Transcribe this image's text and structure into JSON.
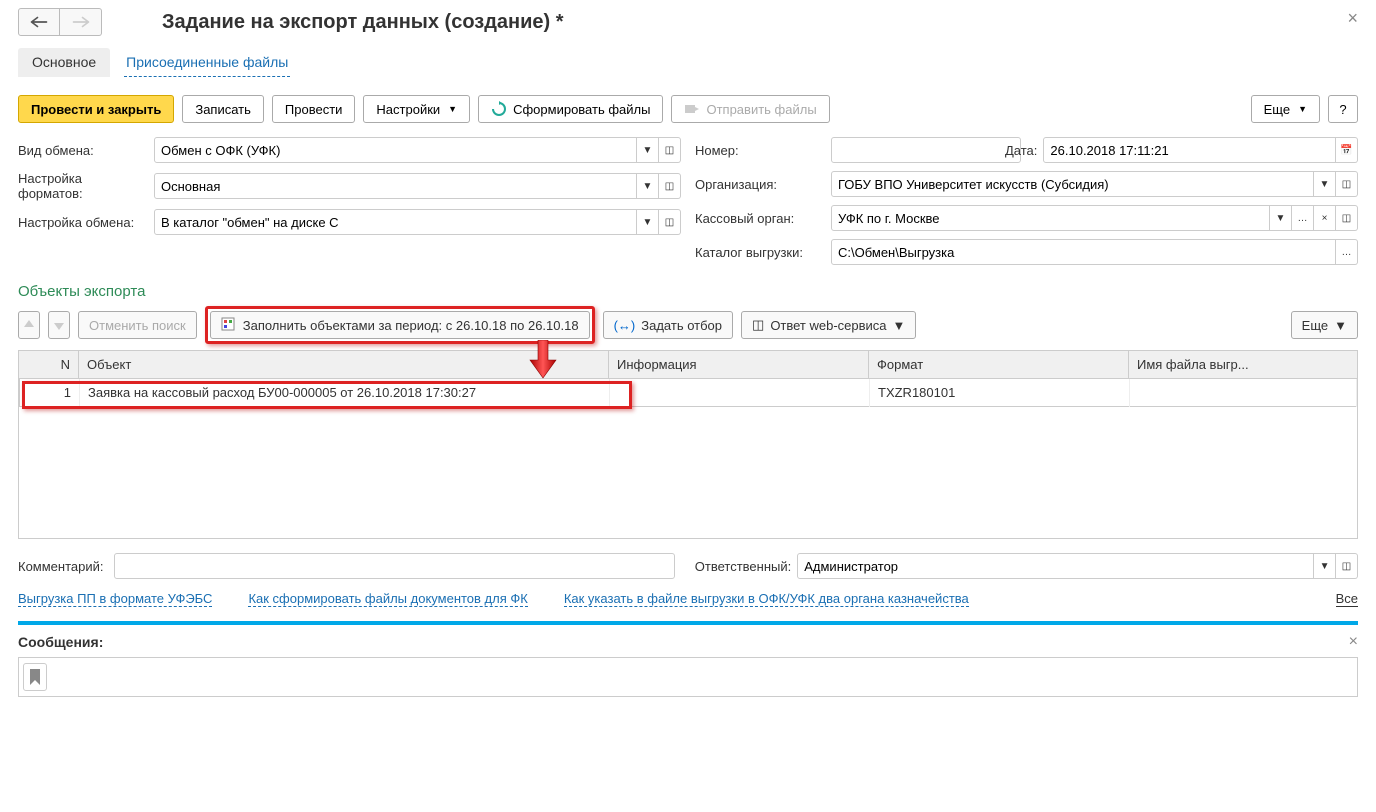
{
  "header": {
    "title": "Задание на экспорт данных (создание) *"
  },
  "tabs": {
    "main": "Основное",
    "files": "Присоединенные файлы"
  },
  "toolbar": {
    "post_close": "Провести и закрыть",
    "save": "Записать",
    "post": "Провести",
    "settings": "Настройки",
    "generate_files": "Сформировать файлы",
    "send_files": "Отправить файлы",
    "more": "Еще",
    "help": "?"
  },
  "form": {
    "exchange_type_label": "Вид обмена:",
    "exchange_type_value": "Обмен с ОФК (УФК)",
    "format_setting_label": "Настройка форматов:",
    "format_setting_value": "Основная",
    "exchange_setting_label": "Настройка обмена:",
    "exchange_setting_value": "В каталог \"обмен\" на диске C",
    "number_label": "Номер:",
    "number_value": "",
    "date_label": "Дата:",
    "date_value": "26.10.2018 17:11:21",
    "organization_label": "Организация:",
    "organization_value": "ГОБУ ВПО Университет искусств (Субсидия)",
    "cash_organ_label": "Кассовый орган:",
    "cash_organ_value": "УФК по г. Москве",
    "export_dir_label": "Каталог выгрузки:",
    "export_dir_value": "C:\\Обмен\\Выгрузка"
  },
  "objects": {
    "section_title": "Объекты экспорта",
    "cancel_search": "Отменить поиск",
    "fill_period": "Заполнить объектами за период: с 26.10.18 по 26.10.18",
    "set_filter": "Задать отбор",
    "web_response": "Ответ web-сервиса",
    "more": "Еще",
    "cols": {
      "n": "N",
      "object": "Объект",
      "info": "Информация",
      "format": "Формат",
      "filename": "Имя файла выгр..."
    },
    "rows": [
      {
        "n": "1",
        "object": "Заявка на кассовый расход БУ00-000005 от 26.10.2018 17:30:27",
        "info": "",
        "format": "TXZR180101",
        "filename": ""
      }
    ]
  },
  "footer": {
    "comment_label": "Комментарий:",
    "comment_value": "",
    "responsible_label": "Ответственный:",
    "responsible_value": "Администратор",
    "link1": "Выгрузка ПП в формате УФЭБС",
    "link2": "Как сформировать файлы документов для ФК",
    "link3": "Как указать в файле выгрузки в ОФК/УФК два органа казначейства",
    "all": "Все"
  },
  "messages": {
    "title": "Сообщения:"
  }
}
